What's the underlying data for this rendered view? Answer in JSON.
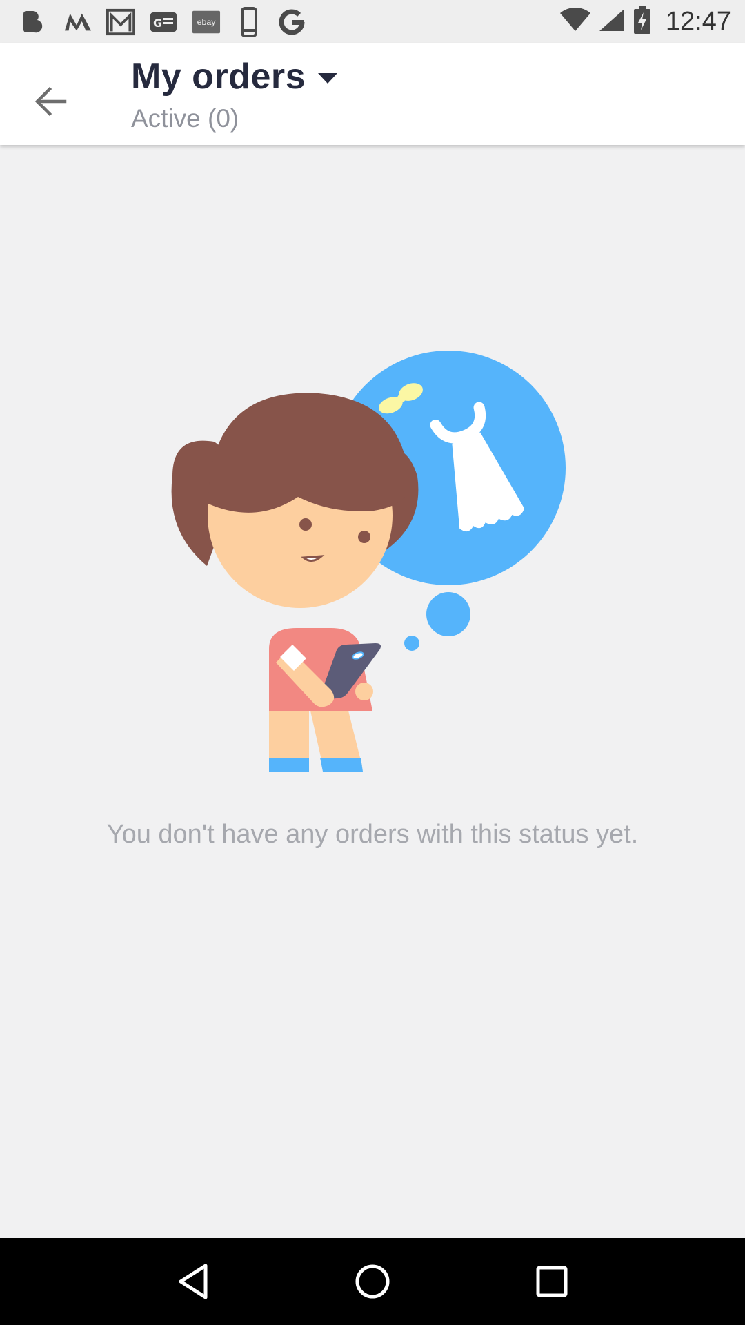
{
  "status_bar": {
    "time": "12:47",
    "notification_icons": [
      "b-app-icon",
      "m-app-icon",
      "gmail-icon",
      "news-icon",
      "ebay-icon",
      "phone-icon",
      "google-icon"
    ],
    "ebay_label": "ebay",
    "system_icons": [
      "wifi-icon",
      "cell-signal-icon",
      "battery-charging-icon"
    ]
  },
  "app_bar": {
    "title": "My orders",
    "subtitle": "Active (0)"
  },
  "empty_state": {
    "message": "You don't have any orders with this status yet."
  },
  "colors": {
    "bubble_blue": "#55b4fb",
    "hair_brown": "#87544a",
    "skin": "#fdcf9f",
    "shirt_pink": "#f28882",
    "phone_dark": "#5c5c78",
    "bow_yellow": "#fbf7a4"
  },
  "nav_bar": {
    "buttons": [
      "back-nav-icon",
      "home-nav-icon",
      "recents-nav-icon"
    ]
  }
}
